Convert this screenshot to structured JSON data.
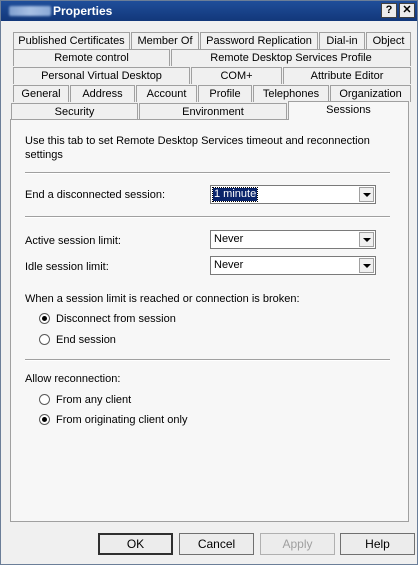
{
  "window": {
    "title": "Properties",
    "help_label": "?",
    "close_label": "✕"
  },
  "tabs": {
    "row1": [
      "Published Certificates",
      "Member Of",
      "Password Replication",
      "Dial-in",
      "Object"
    ],
    "row2": [
      "Remote control",
      "Remote Desktop Services Profile"
    ],
    "row3": [
      "Personal Virtual Desktop",
      "COM+",
      "Attribute Editor"
    ],
    "row4": [
      "General",
      "Address",
      "Account",
      "Profile",
      "Telephones",
      "Organization"
    ],
    "row5": [
      "Security",
      "Environment",
      "Sessions"
    ]
  },
  "sessions": {
    "intro": "Use this tab to set Remote Desktop Services timeout and reconnection settings",
    "end_disconnected_label": "End a disconnected session:",
    "end_disconnected_value": "1 minute",
    "active_limit_label": "Active session limit:",
    "active_limit_value": "Never",
    "idle_limit_label": "Idle session limit:",
    "idle_limit_value": "Never",
    "limit_group_label": "When a session limit is reached or connection is broken:",
    "disconnect_option": "Disconnect from session",
    "end_option": "End session",
    "reconnect_group_label": "Allow reconnection:",
    "any_client_option": "From any client",
    "originating_client_option": "From originating client only"
  },
  "buttons": {
    "ok": "OK",
    "cancel": "Cancel",
    "apply": "Apply",
    "help": "Help"
  }
}
